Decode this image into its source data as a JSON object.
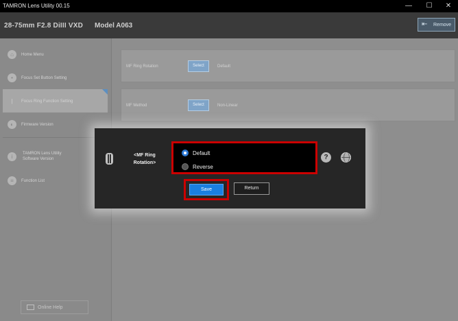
{
  "window": {
    "title": "TAMRON Lens Utility  00.15",
    "minimize_glyph": "—",
    "maximize_glyph": "☐",
    "close_glyph": "✕"
  },
  "header": {
    "lens_name": "28-75mm F2.8 DiIII VXD",
    "model": "Model A063",
    "remove_label": "Remove",
    "remove_icon": "remove-lens-icon"
  },
  "sidebar": {
    "items": [
      {
        "label": "Home Menu",
        "icon": "home-icon"
      },
      {
        "label": "Focus Set Button Setting",
        "icon": "focus-button-icon"
      },
      {
        "label": "Focus Ring Function Setting",
        "icon": "focus-ring-icon"
      },
      {
        "label": "Firmware Version",
        "icon": "firmware-icon"
      },
      {
        "label_line1": "TAMRON Lens Utility",
        "label_line2": "Software Version",
        "icon": "info-icon"
      },
      {
        "label": "Function List",
        "icon": "list-icon"
      }
    ],
    "active_index": 2,
    "online_help_label": "Online Help"
  },
  "settings": [
    {
      "label": "MF Ring Rotation",
      "select_label": "Select",
      "value": "Default"
    },
    {
      "label": "MF Method",
      "select_label": "Select",
      "value": "Non-Linear"
    }
  ],
  "dialog": {
    "title_line1": "<MF Ring",
    "title_line2": "Rotation>",
    "options": [
      {
        "label": "Default",
        "selected": true
      },
      {
        "label": "Reverse",
        "selected": false
      }
    ],
    "help_glyph": "?",
    "save_label": "Save",
    "return_label": "Return"
  },
  "colors": {
    "accent_blue": "#1a7fe0",
    "highlight_red": "#cc0000",
    "dialog_bg": "#262626",
    "dimmed_bg": "#8e8e8e"
  }
}
